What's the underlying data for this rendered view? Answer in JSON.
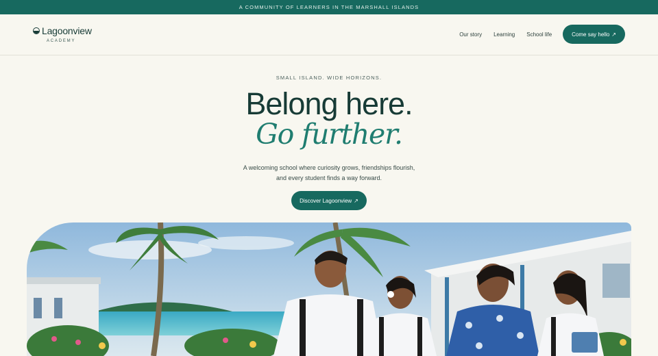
{
  "announcement": "A COMMUNITY OF LEARNERS IN THE MARSHALL ISLANDS",
  "logo": {
    "name": "Lagoonview",
    "sub": "ACADEMY",
    "icon": "logo-circle-icon"
  },
  "nav": {
    "links": [
      "Our story",
      "Learning",
      "School life"
    ],
    "cta_label": "Come say hello",
    "cta_icon": "↗"
  },
  "hero": {
    "eyebrow": "SMALL ISLAND. WIDE HORIZONS.",
    "headline": "Belong here.",
    "headline_italic": "Go further.",
    "lede_line1": "A welcoming school where curiosity grows, friendships flourish,",
    "lede_line2": "and every student finds a way forward.",
    "cta_label": "Discover Lagoonview",
    "cta_icon": "↗"
  },
  "colors": {
    "brand": "#17695f",
    "accent": "#1f7d70",
    "background": "#f8f7f0",
    "ink": "#173b36"
  }
}
